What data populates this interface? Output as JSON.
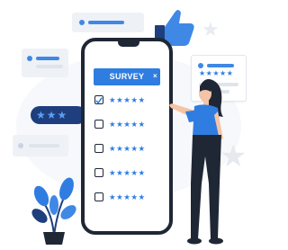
{
  "survey": {
    "title": "SURVEY",
    "close_symbol": "×",
    "rows": [
      {
        "checked": true,
        "stars": "★★★★★"
      },
      {
        "checked": false,
        "stars": "★★★★★"
      },
      {
        "checked": false,
        "stars": "★★★★★"
      },
      {
        "checked": false,
        "stars": "★★★★★"
      },
      {
        "checked": false,
        "stars": "★★★★★"
      }
    ]
  },
  "decor": {
    "left_rating_stars": "★★★",
    "card_stars": "★★★★★",
    "accent_color": "#2f7de1",
    "navy_color": "#1f3e7d",
    "icons": [
      "thumbs-up-icon",
      "leaf-plant-icon",
      "star-icon",
      "check-icon",
      "woman-figure"
    ]
  }
}
